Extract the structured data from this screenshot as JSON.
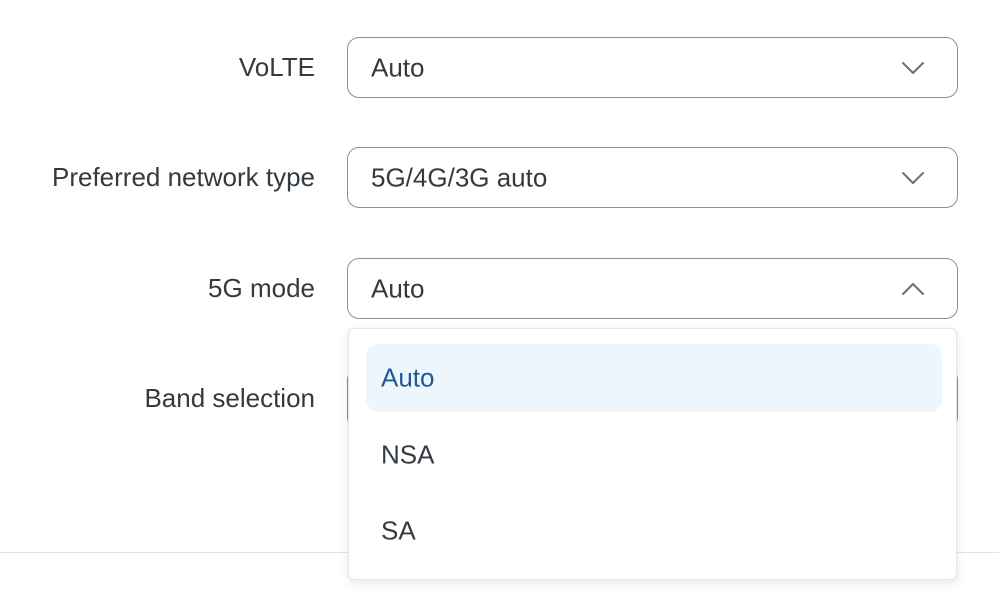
{
  "form": {
    "volte": {
      "label": "VoLTE",
      "value": "Auto"
    },
    "preferred_network_type": {
      "label": "Preferred network type",
      "value": "5G/4G/3G auto"
    },
    "fiveg_mode": {
      "label": "5G mode",
      "value": "Auto",
      "expanded": true,
      "options": [
        {
          "label": "Auto",
          "selected": true
        },
        {
          "label": "NSA",
          "selected": false
        },
        {
          "label": "SA",
          "selected": false
        }
      ]
    },
    "band_selection": {
      "label": "Band selection"
    }
  },
  "icons": {
    "collapsed": "chevron-down-icon",
    "expanded": "chevron-up-icon"
  },
  "colors": {
    "text": "#333a40",
    "border": "#8d9094",
    "selected_bg": "#eef6fd",
    "selected_text": "#1e5a9a"
  }
}
